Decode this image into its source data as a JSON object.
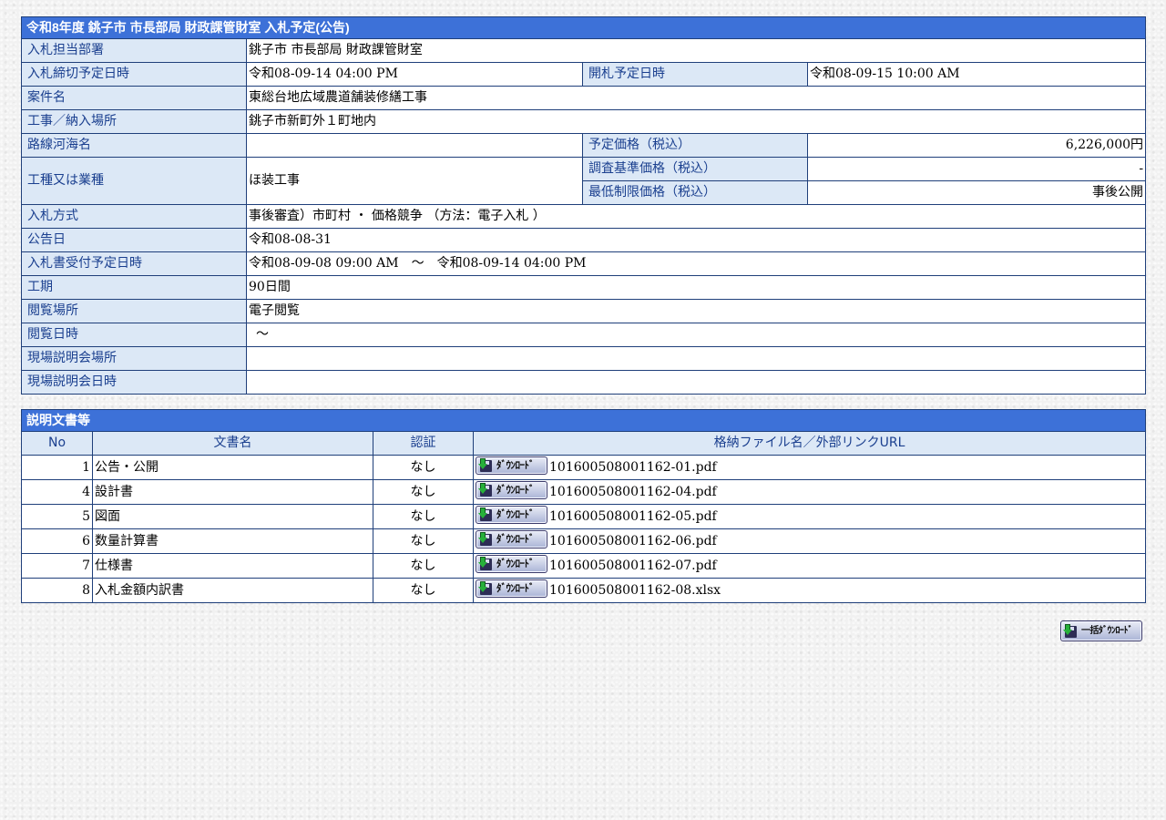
{
  "notice": {
    "title": "令和8年度 銚子市 市長部局 財政課管財室 入札予定(公告)",
    "rows": {
      "department": {
        "label": "入札担当部署",
        "value": "銚子市 市長部局 財政課管財室"
      },
      "deadline": {
        "label": "入札締切予定日時",
        "value": "令和08-09-14 04:00 PM"
      },
      "opening": {
        "label": "開札予定日時",
        "value": "令和08-09-15 10:00 AM"
      },
      "project_name": {
        "label": "案件名",
        "value": "東総台地広域農道舗装修繕工事"
      },
      "location": {
        "label": "工事／納入場所",
        "value": "銚子市新町外１町地内"
      },
      "route": {
        "label": "路線河海名",
        "value": ""
      },
      "planned_price": {
        "label": "予定価格（税込）",
        "value": "6,226,000円"
      },
      "work_type": {
        "label": "工種又は業種",
        "value": "ほ装工事"
      },
      "survey_price": {
        "label": "調査基準価格（税込）",
        "value": "-"
      },
      "min_price": {
        "label": "最低制限価格（税込）",
        "value": "事後公開"
      },
      "method": {
        "label": "入札方式",
        "value": "事後審査）市町村 ・ 価格競争 （方法：電子入札 ）"
      },
      "announce_date": {
        "label": "公告日",
        "value": "令和08-08-31"
      },
      "receipt_period": {
        "label": "入札書受付予定日時",
        "value": "令和08-09-08 09:00 AM　～　令和08-09-14 04:00 PM"
      },
      "period": {
        "label": "工期",
        "value": "90日間"
      },
      "view_place": {
        "label": "閲覧場所",
        "value": "電子閲覧"
      },
      "view_datetime": {
        "label": "閲覧日時",
        "value": "～"
      },
      "briefing_place": {
        "label": "現場説明会場所",
        "value": ""
      },
      "briefing_datetime": {
        "label": "現場説明会日時",
        "value": ""
      }
    }
  },
  "documents": {
    "title": "説明文書等",
    "columns": {
      "no": "No",
      "name": "文書名",
      "auth": "認証",
      "file": "格納ファイル名／外部リンクURL"
    },
    "download_label": "ﾀﾞｳﾝﾛｰﾄﾞ",
    "items": [
      {
        "no": "1",
        "name": "公告・公開",
        "auth": "なし",
        "file": "101600508001162-01.pdf"
      },
      {
        "no": "4",
        "name": "設計書",
        "auth": "なし",
        "file": "101600508001162-04.pdf"
      },
      {
        "no": "5",
        "name": "図面",
        "auth": "なし",
        "file": "101600508001162-05.pdf"
      },
      {
        "no": "6",
        "name": "数量計算書",
        "auth": "なし",
        "file": "101600508001162-06.pdf"
      },
      {
        "no": "7",
        "name": "仕様書",
        "auth": "なし",
        "file": "101600508001162-07.pdf"
      },
      {
        "no": "8",
        "name": "入札金額内訳書",
        "auth": "なし",
        "file": "101600508001162-08.xlsx"
      }
    ]
  },
  "bulk_download_label": "一括ﾀﾞｳﾝﾛｰﾄﾞ",
  "colors": {
    "title_bg": "#3d71d8",
    "label_bg": "#dce8f6",
    "label_text": "#1a3f8f",
    "border": "#1f3f7a"
  }
}
